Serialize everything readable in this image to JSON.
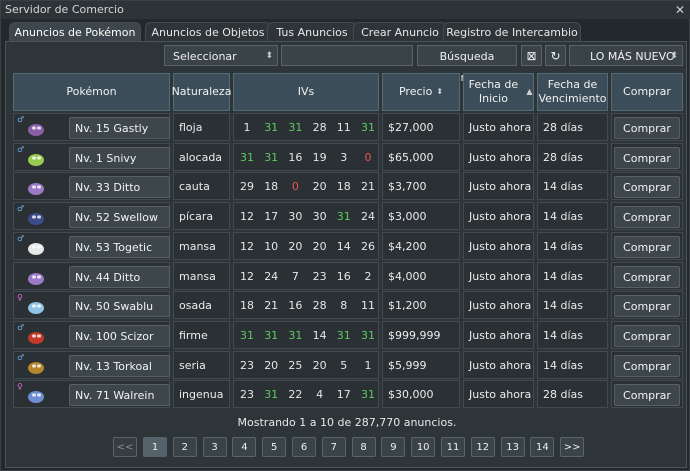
{
  "window": {
    "title": "Servidor de Comercio"
  },
  "tabs": [
    {
      "label": "Anuncios de Pokémon",
      "active": true
    },
    {
      "label": "Anuncios de Objetos",
      "active": false
    },
    {
      "label": "Tus Anuncios",
      "active": false
    },
    {
      "label": "Crear Anuncio",
      "active": false
    },
    {
      "label": "Registro de Intercambio",
      "active": false
    }
  ],
  "toolbar": {
    "template_select": "Seleccionar Plantilla",
    "search_value": "",
    "advanced_search": "Búsqueda Avanzada",
    "sort_select": "LO MÁS NUEVO"
  },
  "headers": {
    "pokemon": "Pokémon",
    "nature": "Naturaleza",
    "ivs": "IVs",
    "price": "Precio",
    "start": "Fecha de Inicio",
    "expiry": "Fecha de Vencimiento",
    "buy": "Comprar"
  },
  "colors": {
    "iv_perfect": "#5fc95f",
    "iv_zero": "#e05a4f",
    "male": "#6fb0e8",
    "female": "#e46ad8"
  },
  "rows": [
    {
      "pokemon": "Nv. 15 Gastly",
      "gender": "♂",
      "sprite": "gastly-icon",
      "nature": "floja",
      "ivs": [
        1,
        31,
        31,
        28,
        11,
        31
      ],
      "price": "$27,000",
      "start": "Justo ahora",
      "expiry": "28 días",
      "buy": "Comprar"
    },
    {
      "pokemon": "Nv. 1 Snivy",
      "gender": "♂",
      "sprite": "snivy-icon",
      "nature": "alocada",
      "ivs": [
        31,
        31,
        16,
        19,
        3,
        0
      ],
      "price": "$65,000",
      "start": "Justo ahora",
      "expiry": "28 días",
      "buy": "Comprar"
    },
    {
      "pokemon": "Nv. 33 Ditto",
      "gender": "",
      "sprite": "ditto-icon",
      "nature": "cauta",
      "ivs": [
        29,
        18,
        0,
        20,
        18,
        21
      ],
      "price": "$3,700",
      "start": "Justo ahora",
      "expiry": "14 días",
      "buy": "Comprar"
    },
    {
      "pokemon": "Nv. 52 Swellow",
      "gender": "♂",
      "sprite": "swellow-icon",
      "nature": "pícara",
      "ivs": [
        12,
        17,
        30,
        30,
        31,
        24
      ],
      "price": "$3,000",
      "start": "Justo ahora",
      "expiry": "14 días",
      "buy": "Comprar"
    },
    {
      "pokemon": "Nv. 53 Togetic",
      "gender": "♂",
      "sprite": "togetic-icon",
      "nature": "mansa",
      "ivs": [
        12,
        10,
        20,
        20,
        14,
        26
      ],
      "price": "$4,200",
      "start": "Justo ahora",
      "expiry": "14 días",
      "buy": "Comprar"
    },
    {
      "pokemon": "Nv. 44 Ditto",
      "gender": "",
      "sprite": "ditto-icon",
      "nature": "mansa",
      "ivs": [
        12,
        24,
        7,
        23,
        16,
        2
      ],
      "price": "$4,000",
      "start": "Justo ahora",
      "expiry": "14 días",
      "buy": "Comprar"
    },
    {
      "pokemon": "Nv. 50 Swablu",
      "gender": "♀",
      "sprite": "swablu-icon",
      "nature": "osada",
      "ivs": [
        18,
        21,
        16,
        28,
        8,
        11
      ],
      "price": "$1,200",
      "start": "Justo ahora",
      "expiry": "14 días",
      "buy": "Comprar"
    },
    {
      "pokemon": "Nv. 100 Scizor",
      "gender": "♂",
      "sprite": "scizor-icon",
      "nature": "firme",
      "ivs": [
        31,
        31,
        31,
        14,
        31,
        31
      ],
      "price": "$999,999",
      "start": "Justo ahora",
      "expiry": "14 días",
      "buy": "Comprar"
    },
    {
      "pokemon": "Nv. 13 Torkoal",
      "gender": "♂",
      "sprite": "torkoal-icon",
      "nature": "seria",
      "ivs": [
        23,
        20,
        25,
        20,
        5,
        1
      ],
      "price": "$5,999",
      "start": "Justo ahora",
      "expiry": "14 días",
      "buy": "Comprar"
    },
    {
      "pokemon": "Nv. 71 Walrein",
      "gender": "♀",
      "sprite": "walrein-icon",
      "nature": "ingenua",
      "ivs": [
        23,
        31,
        22,
        4,
        17,
        31
      ],
      "price": "$30,000",
      "start": "Justo ahora",
      "expiry": "28 días",
      "buy": "Comprar"
    }
  ],
  "footer": {
    "showing": "Mostrando 1 a 10 de 287,770 anuncios.",
    "prev": "<<",
    "next": ">>",
    "pages": [
      "1",
      "2",
      "3",
      "4",
      "5",
      "6",
      "7",
      "8",
      "9",
      "10",
      "11",
      "12",
      "13",
      "14"
    ],
    "current_page": "1"
  }
}
